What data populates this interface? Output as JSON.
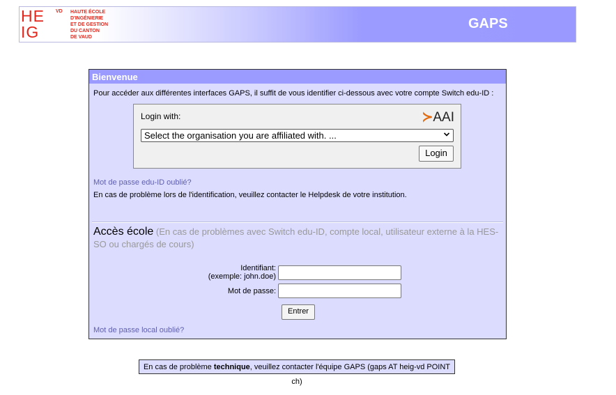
{
  "header": {
    "logo_line1": "HE",
    "logo_line2": "IG",
    "logo_vd": "VD",
    "logo_text": [
      "HAUTE ÉCOLE",
      "D'INGÉNIERIE",
      "ET DE GESTION",
      "DU CANTON",
      "DE VAUD"
    ],
    "title": "GAPS"
  },
  "panel": {
    "heading": "Bienvenue",
    "intro": "Pour accéder aux différentes interfaces GAPS, il suffit de vous identifier ci-dessous avec votre compte Switch edu-ID :",
    "aai": {
      "label": "Login with:",
      "logo_arrow": "≻",
      "logo_text": "AAI",
      "select_value": "Select the organisation you are affiliated with. ...",
      "login_button": "Login"
    },
    "forgot_eduid": "Mot de passe edu-ID oublié?",
    "problem_text": "En cas de problème lors de l'identification, veuillez contacter le Helpdesk de votre institution.",
    "acces_title": "Accès école",
    "acces_note": "(En cas de problèmes avec Switch edu-ID, compte local, utilisateur externe à la HES-SO ou chargés de cours)",
    "login_form": {
      "id_label": "Identifiant:",
      "id_example": "(exemple: john.doe)",
      "id_value": "",
      "password_label": "Mot de passe:",
      "password_value": "",
      "submit": "Entrer"
    },
    "forgot_local": "Mot de passe local oublié?"
  },
  "footer": {
    "prefix": "En cas de problème ",
    "bold": "technique",
    "suffix": ", veuillez contacter l'équipe GAPS (gaps AT heig-vd POINT ch)"
  },
  "colors": {
    "brand_red": "#e2261b",
    "panel_bg": "#dcdcff",
    "panel_header": "#9a9aff",
    "link": "#6060b0"
  }
}
